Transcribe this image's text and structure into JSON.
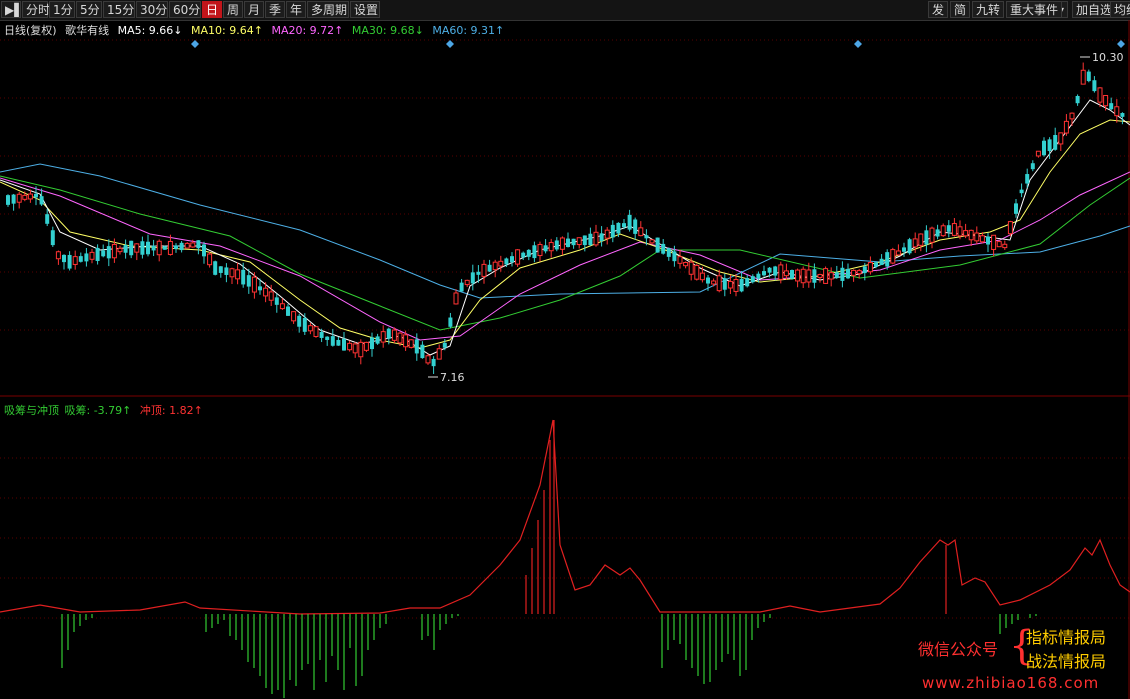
{
  "toolbar": {
    "left": [
      {
        "id": "fenshi",
        "label": "分时"
      },
      {
        "id": "1m",
        "label": "1分"
      },
      {
        "id": "5m",
        "label": "5分"
      },
      {
        "id": "15m",
        "label": "15分"
      },
      {
        "id": "30m",
        "label": "30分"
      },
      {
        "id": "60m",
        "label": "60分"
      },
      {
        "id": "day",
        "label": "日",
        "active": true
      },
      {
        "id": "week",
        "label": "周"
      },
      {
        "id": "month",
        "label": "月"
      },
      {
        "id": "season",
        "label": "季"
      },
      {
        "id": "year",
        "label": "年"
      },
      {
        "id": "multi",
        "label": "多周期"
      },
      {
        "id": "settings",
        "label": "设置"
      }
    ],
    "right": [
      {
        "id": "fa",
        "label": "发"
      },
      {
        "id": "jian",
        "label": "简"
      },
      {
        "id": "jiuzhuan",
        "label": "九转"
      },
      {
        "id": "events",
        "label": "重大事件"
      },
      {
        "id": "add",
        "label": "加自选"
      },
      {
        "id": "junxian",
        "label": "均线"
      }
    ]
  },
  "main_info": {
    "period": "日线(复权)",
    "name": "歌华有线",
    "ma5": "MA5: 9.66↓",
    "ma10": "MA10: 9.64↑",
    "ma20": "MA20: 9.72↑",
    "ma30": "MA30: 9.68↓",
    "ma60": "MA60: 9.31↑"
  },
  "sub_info": {
    "name": "吸筹与冲顶",
    "xichou": "吸筹: -3.79↑",
    "chongding": "冲顶: 1.82↑"
  },
  "labels": {
    "high": "10.30",
    "low": "7.16"
  },
  "colors": {
    "up": "#ff3333",
    "down": "#33d0d0",
    "ma5": "#ffffff",
    "ma10": "#ffff66",
    "ma20": "#ff66ff",
    "ma30": "#33cc33",
    "ma60": "#4dafe6",
    "green_bar": "#33cc33",
    "red_line": "#e02020",
    "grid": "#5a0000"
  },
  "watermark": {
    "line1": "微信公众号",
    "line2": "指标情报局",
    "line3": "战法情报局",
    "url": "www.zhibiao168.com"
  }
}
